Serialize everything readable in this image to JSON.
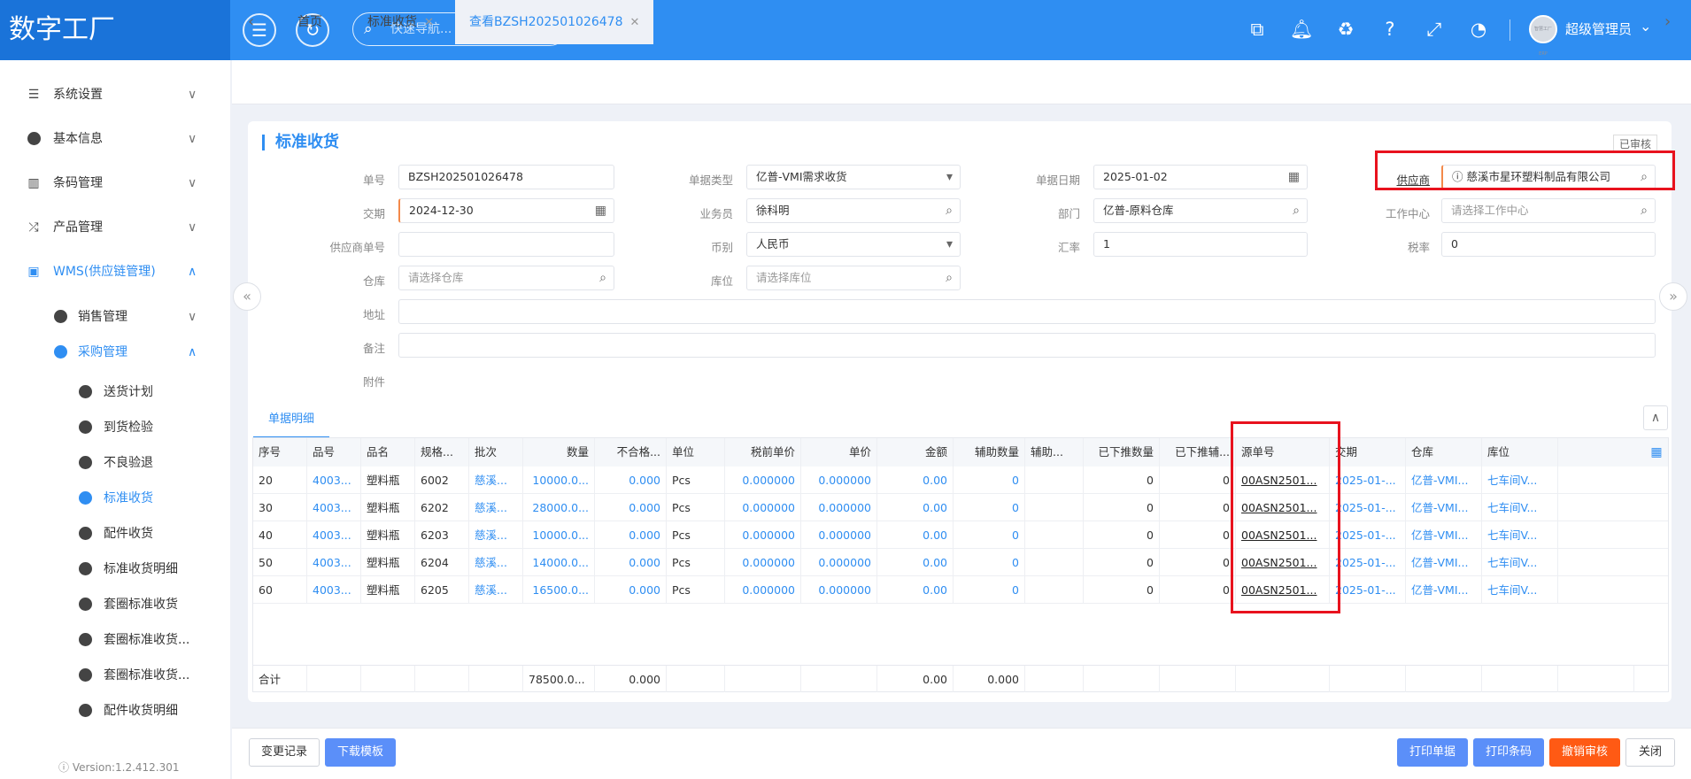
{
  "app": {
    "logo": "数字工厂",
    "search_placeholder": "快速导航...",
    "user": "超级管理员",
    "avatar_text": "智慧工厂 ERP",
    "version": "Version:1.2.412.301"
  },
  "sidebar": [
    {
      "label": "系统设置",
      "icon": "list-icon",
      "chevron": "∨"
    },
    {
      "label": "基本信息",
      "icon": "compass-icon",
      "chevron": "∨"
    },
    {
      "label": "条码管理",
      "icon": "barcode-icon",
      "chevron": "∨"
    },
    {
      "label": "产品管理",
      "icon": "shuffle-icon",
      "chevron": "∨"
    },
    {
      "label": "WMS(供应链管理)",
      "icon": "train-icon",
      "chevron": "∧"
    },
    {
      "label": "销售管理",
      "icon": "compass-icon",
      "chevron": "∨"
    },
    {
      "label": "采购管理",
      "icon": "compass-icon",
      "chevron": "∧"
    },
    {
      "label": "送货计划",
      "icon": "compass-icon"
    },
    {
      "label": "到货检验",
      "icon": "compass-icon"
    },
    {
      "label": "不良验退",
      "icon": "compass-icon"
    },
    {
      "label": "标准收货",
      "icon": "compass-icon"
    },
    {
      "label": "配件收货",
      "icon": "compass-icon"
    },
    {
      "label": "标准收货明细",
      "icon": "compass-icon"
    },
    {
      "label": "套圈标准收货",
      "icon": "compass-icon"
    },
    {
      "label": "套圈标准收货...",
      "icon": "compass-icon"
    },
    {
      "label": "套圈标准收货...",
      "icon": "compass-icon"
    },
    {
      "label": "配件收货明细",
      "icon": "compass-icon"
    }
  ],
  "tabs": [
    {
      "label": "首页"
    },
    {
      "label": "标准收货"
    },
    {
      "label": "查看BZSH202501026478"
    }
  ],
  "form": {
    "title": "标准收货",
    "status": "已审核",
    "labels": {
      "order_no": "单号",
      "doc_type": "单据类型",
      "doc_date": "单据日期",
      "supplier": "供应商",
      "delivery": "交期",
      "salesman": "业务员",
      "dept": "部门",
      "work_center": "工作中心",
      "supplier_no": "供应商单号",
      "currency": "币别",
      "rate": "汇率",
      "tax": "税率",
      "warehouse": "仓库",
      "location": "库位",
      "address": "地址",
      "remark": "备注",
      "attach": "附件"
    },
    "values": {
      "order_no": "BZSH202501026478",
      "doc_type": "亿普-VMI需求收货",
      "doc_date": "2025-01-02",
      "supplier": "慈溪市星环塑料制品有限公司",
      "delivery": "2024-12-30",
      "salesman": "徐科明",
      "dept": "亿普-原料仓库",
      "currency": "人民币",
      "rate": "1",
      "tax": "0"
    },
    "placeholders": {
      "work_center": "请选择工作中心",
      "warehouse": "请选择仓库",
      "location": "请选择库位"
    }
  },
  "detail": {
    "tab": "单据明细",
    "headers": [
      "序号",
      "品号",
      "品名",
      "规格...",
      "批次",
      "数量",
      "不合格...",
      "单位",
      "税前单价",
      "单价",
      "金额",
      "辅助数量",
      "辅助...",
      "已下推数量",
      "已下推辅...",
      "源单号",
      "交期",
      "仓库",
      "库位"
    ],
    "rows": [
      [
        "20",
        "4003...",
        "塑料瓶",
        "6002",
        "慈溪...",
        "10000.0...",
        "0.000",
        "Pcs",
        "0.000000",
        "0.000000",
        "0.00",
        "0",
        "",
        "0",
        "0",
        "00ASN2501...",
        "2025-01-...",
        "亿普-VMI...",
        "七车间V..."
      ],
      [
        "30",
        "4003...",
        "塑料瓶",
        "6202",
        "慈溪...",
        "28000.0...",
        "0.000",
        "Pcs",
        "0.000000",
        "0.000000",
        "0.00",
        "0",
        "",
        "0",
        "0",
        "00ASN2501...",
        "2025-01-...",
        "亿普-VMI...",
        "七车间V..."
      ],
      [
        "40",
        "4003...",
        "塑料瓶",
        "6203",
        "慈溪...",
        "10000.0...",
        "0.000",
        "Pcs",
        "0.000000",
        "0.000000",
        "0.00",
        "0",
        "",
        "0",
        "0",
        "00ASN2501...",
        "2025-01-...",
        "亿普-VMI...",
        "七车间V..."
      ],
      [
        "50",
        "4003...",
        "塑料瓶",
        "6204",
        "慈溪...",
        "14000.0...",
        "0.000",
        "Pcs",
        "0.000000",
        "0.000000",
        "0.00",
        "0",
        "",
        "0",
        "0",
        "00ASN2501...",
        "2025-01-...",
        "亿普-VMI...",
        "七车间V..."
      ],
      [
        "60",
        "4003...",
        "塑料瓶",
        "6205",
        "慈溪...",
        "16500.0...",
        "0.000",
        "Pcs",
        "0.000000",
        "0.000000",
        "0.00",
        "0",
        "",
        "0",
        "0",
        "00ASN2501...",
        "2025-01-...",
        "亿普-VMI...",
        "七车间V..."
      ]
    ],
    "total": {
      "label": "合计",
      "qty": "78500.0...",
      "bad": "0.000",
      "amount": "0.00",
      "aux": "0.000"
    }
  },
  "footer": {
    "change_log": "变更记录",
    "download": "下载模板",
    "print_doc": "打印单据",
    "print_code": "打印条码",
    "revoke": "撤销审核",
    "close": "关闭"
  }
}
